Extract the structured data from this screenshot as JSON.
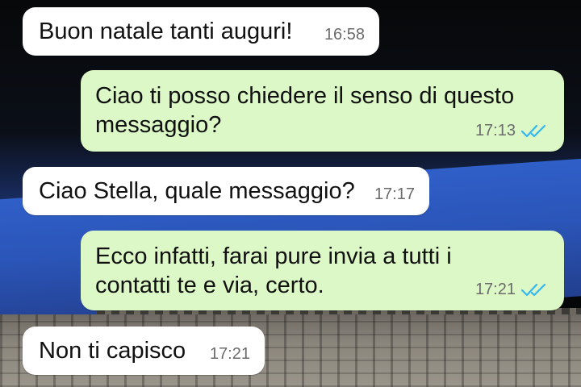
{
  "messages": [
    {
      "direction": "incoming",
      "text": "Buon natale tanti auguri!",
      "time": "16:58"
    },
    {
      "direction": "outgoing",
      "text": "Ciao ti posso chiedere il senso di questo\nmessaggio?",
      "time": "17:13",
      "status": "read",
      "status_icon": "double-check-icon"
    },
    {
      "direction": "incoming",
      "text": "Ciao Stella, quale messaggio?",
      "time": "17:17"
    },
    {
      "direction": "outgoing",
      "text": "Ecco infatti, farai pure invia a tutti i\ncontatti te e via, certo.",
      "time": "17:21",
      "status": "read",
      "status_icon": "double-check-icon"
    },
    {
      "direction": "incoming",
      "text": "Non ti capisco",
      "time": "17:21"
    }
  ],
  "colors": {
    "incoming_bubble": "#ffffff",
    "outgoing_bubble": "#dcf8c6",
    "read_tick": "#34b7f1",
    "time_text": "#6b6b6b"
  }
}
